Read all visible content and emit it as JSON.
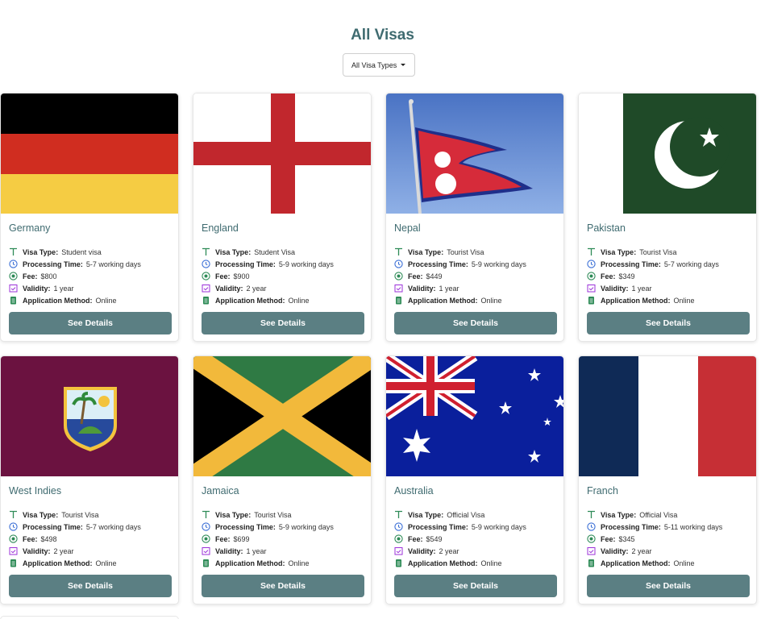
{
  "page": {
    "title": "All Visas"
  },
  "filter": {
    "label": "All Visa Types"
  },
  "labels": {
    "visa_type": "Visa Type:",
    "processing_time": "Processing Time:",
    "fee": "Fee:",
    "validity": "Validity:",
    "application_method": "Application Method:",
    "button": "See Details"
  },
  "colors": {
    "accent": "#3f6b70",
    "button": "#5b7f83",
    "type_icon": "#2e8b57",
    "time_icon": "#3b6fd6",
    "fee_icon": "#2e8b57",
    "validity_icon": "#9b30d9",
    "method_icon": "#2e8b57"
  },
  "visas": [
    {
      "country": "Germany",
      "flag": "germany",
      "visa_type": "Student visa",
      "processing_time": "5-7 working days",
      "fee": "$800",
      "validity": "1 year",
      "application_method": "Online"
    },
    {
      "country": "England",
      "flag": "england",
      "visa_type": "Student Visa",
      "processing_time": "5-9 working days",
      "fee": "$900",
      "validity": "2 year",
      "application_method": "Online"
    },
    {
      "country": "Nepal",
      "flag": "nepal",
      "visa_type": "Tourist Visa",
      "processing_time": "5-9 working days",
      "fee": "$449",
      "validity": "1 year",
      "application_method": "Online"
    },
    {
      "country": "Pakistan",
      "flag": "pakistan",
      "visa_type": "Tourist Visa",
      "processing_time": "5-7 working days",
      "fee": "$349",
      "validity": "1 year",
      "application_method": "Online"
    },
    {
      "country": "West Indies",
      "flag": "west-indies",
      "visa_type": "Tourist Visa",
      "processing_time": "5-7 working days",
      "fee": "$498",
      "validity": "2 year",
      "application_method": "Online"
    },
    {
      "country": "Jamaica",
      "flag": "jamaica",
      "visa_type": "Tourist Visa",
      "processing_time": "5-9 working days",
      "fee": "$699",
      "validity": "1 year",
      "application_method": "Online"
    },
    {
      "country": "Australia",
      "flag": "australia",
      "visa_type": "Official Visa",
      "processing_time": "5-9 working days",
      "fee": "$549",
      "validity": "2 year",
      "application_method": "Online"
    },
    {
      "country": "Franch",
      "flag": "france",
      "visa_type": "Official Visa",
      "processing_time": "5-11 working days",
      "fee": "$345",
      "validity": "2 year",
      "application_method": "Online"
    }
  ]
}
